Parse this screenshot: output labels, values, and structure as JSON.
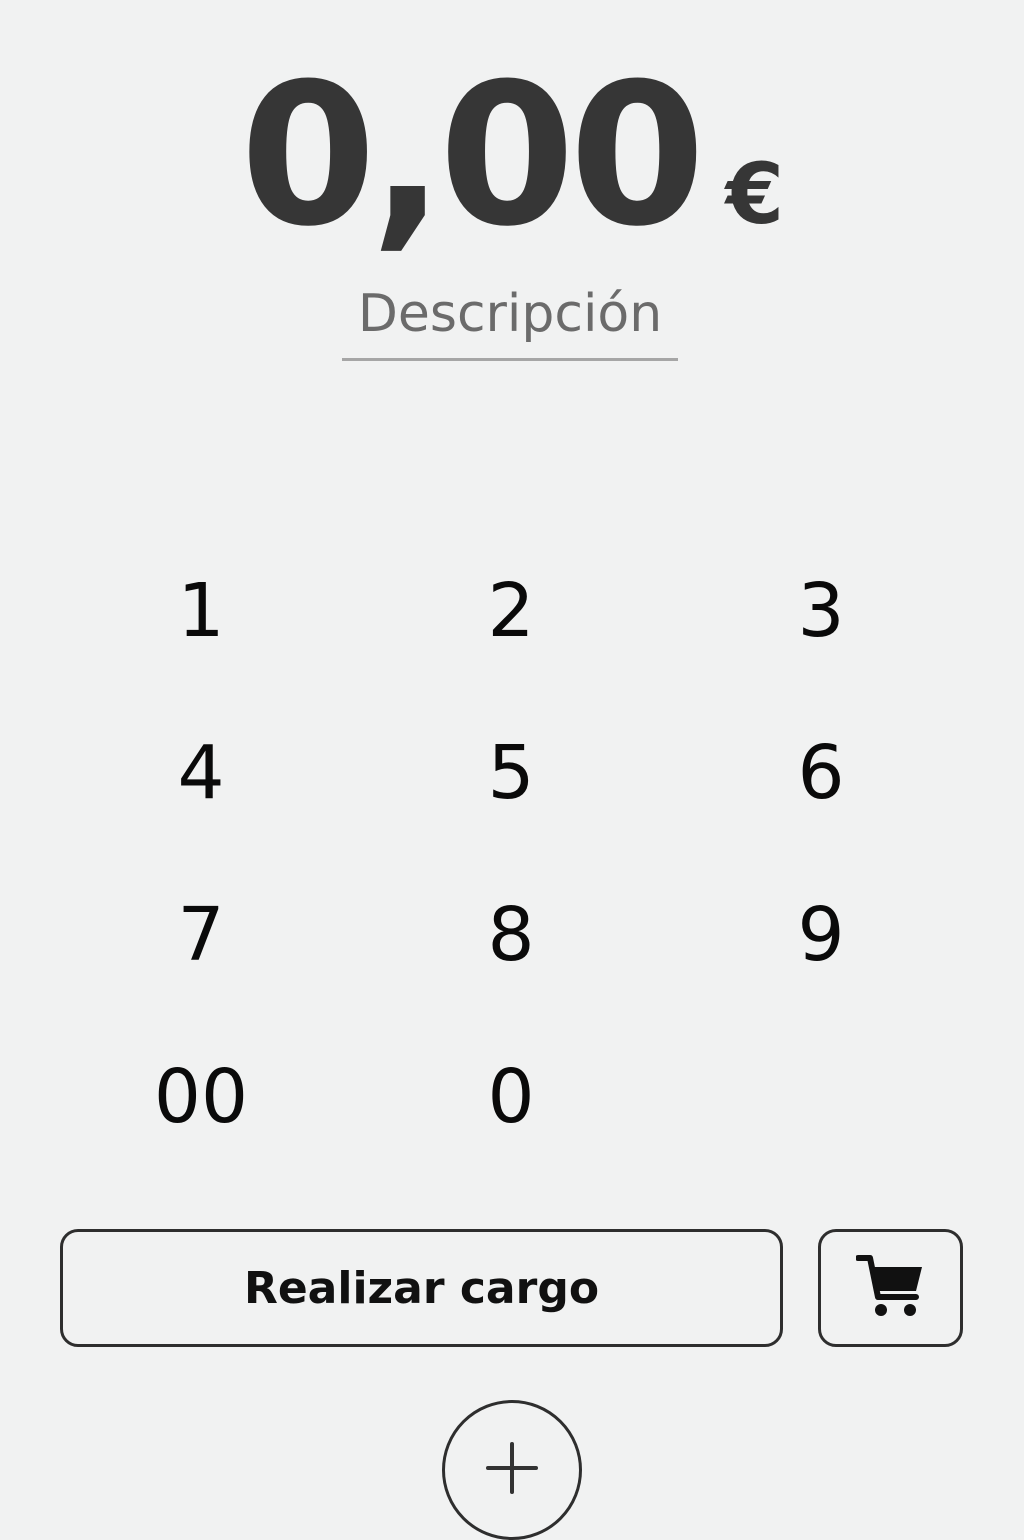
{
  "amount": {
    "value": "0,00",
    "currency": "€"
  },
  "description": {
    "placeholder": "Descripción"
  },
  "keypad": {
    "keys": [
      "1",
      "2",
      "3",
      "4",
      "5",
      "6",
      "7",
      "8",
      "9",
      "00",
      "0"
    ]
  },
  "actions": {
    "charge_label": "Realizar cargo",
    "cart_icon": "cart-icon",
    "add_icon": "plus-icon"
  }
}
